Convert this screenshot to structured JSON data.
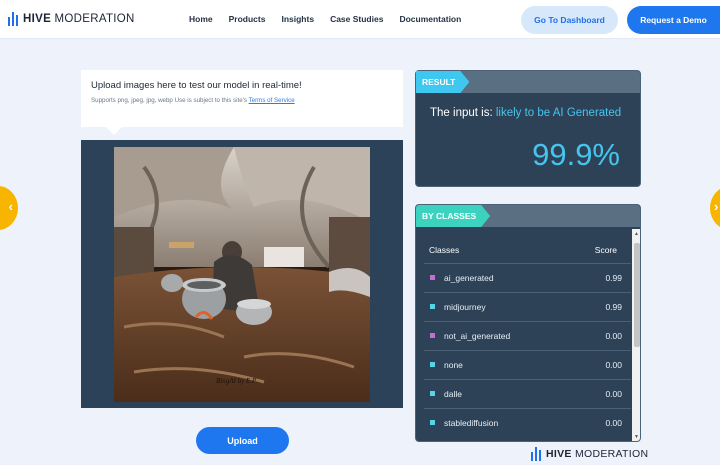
{
  "brand": {
    "bold": "HIVE",
    "light": "MODERATION"
  },
  "nav": [
    "Home",
    "Products",
    "Insights",
    "Case Studies",
    "Documentation"
  ],
  "header_buttons": {
    "dashboard": "Go To Dashboard",
    "demo": "Request a Demo"
  },
  "upload": {
    "title": "Upload images here to test our model in real-time!",
    "subtitle": "Supports png, jpeg, jpg, webp Use is subject to this site's",
    "terms_link": "Terms of Service",
    "button": "Upload",
    "image_watermark": "BingAI by E.P."
  },
  "result": {
    "tag": "RESULT",
    "prefix": "The input is:",
    "verdict": "likely to be AI Generated",
    "score": "99.9%"
  },
  "classes": {
    "tag": "BY CLASSES",
    "col_class": "Classes",
    "col_score": "Score",
    "rows": [
      {
        "label": "ai_generated",
        "score": "0.99",
        "color": "#c76bd6"
      },
      {
        "label": "midjourney",
        "score": "0.99",
        "color": "#56d4e8"
      },
      {
        "label": "not_ai_generated",
        "score": "0.00",
        "color": "#c76bd6"
      },
      {
        "label": "none",
        "score": "0.00",
        "color": "#56d4e8"
      },
      {
        "label": "dalle",
        "score": "0.00",
        "color": "#56d4e8"
      },
      {
        "label": "stablediffusion",
        "score": "0.00",
        "color": "#56d4e8"
      }
    ]
  },
  "colors": {
    "accent_blue": "#1f77f0",
    "result_cyan": "#47c4ec",
    "panel_bg": "#2d4257",
    "carousel_arrow": "#f7b500"
  }
}
